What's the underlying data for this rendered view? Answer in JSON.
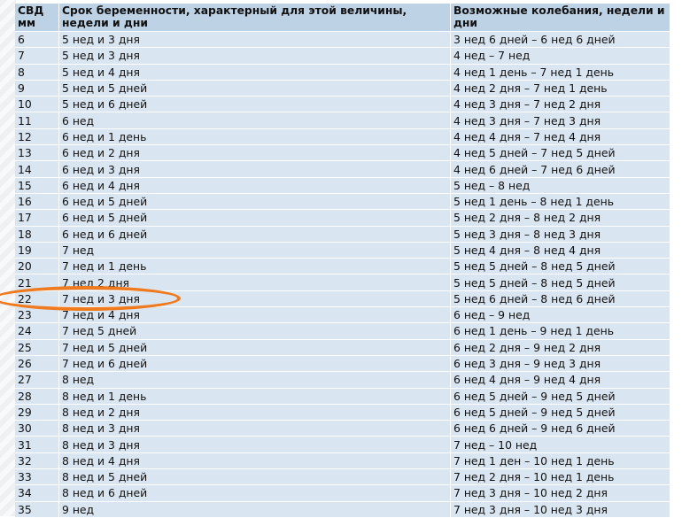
{
  "headers": {
    "col1": "СВД мм",
    "col2": "Срок беременности, характерный для этой величины, недели и дни",
    "col3": "Возможные колебания, недели и дни"
  },
  "rows": [
    [
      "6",
      "5 нед и 3 дня",
      "3 нед 6 дней – 6 нед 6 дней"
    ],
    [
      "7",
      "5 нед и 3 дня",
      "4 нед – 7 нед"
    ],
    [
      "8",
      "5 нед и 4 дня",
      "4 нед 1 день – 7 нед 1 день"
    ],
    [
      "9",
      "5 нед и 5 дней",
      "4 нед 2 дня – 7 нед 1 день"
    ],
    [
      "10",
      "5 нед и 6 дней",
      "4 нед 3 дня – 7 нед 2 дня"
    ],
    [
      "11",
      "6 нед",
      "4 нед 3 дня – 7 нед 3 дня"
    ],
    [
      "12",
      "6 нед и 1 день",
      "4 нед 4 дня – 7 нед 4 дня"
    ],
    [
      "13",
      "6 нед и 2 дня",
      "4 нед 5 дней – 7 нед 5 дней"
    ],
    [
      "14",
      "6 нед и 3 дня",
      "4 нед 6 дней – 7 нед 6 дней"
    ],
    [
      "15",
      "6 нед и 4 дня",
      "5 нед – 8 нед"
    ],
    [
      "16",
      "6 нед и 5 дней",
      "5 нед 1 день – 8 нед 1 день"
    ],
    [
      "17",
      "6 нед и 5 дней",
      "5 нед 2 дня – 8 нед 2 дня"
    ],
    [
      "18",
      "6 нед и 6 дней",
      "5 нед 3 дня – 8 нед 3 дня"
    ],
    [
      "19",
      "7 нед",
      "5 нед 4 дня – 8 нед 4 дня"
    ],
    [
      "20",
      "7 нед и 1 день",
      "5 нед 5 дней – 8 нед 5 дней"
    ],
    [
      "21",
      "7 нед 2 дня",
      "5 нед 5 дней – 8 нед 5 дней"
    ],
    [
      "22",
      "7 нед и 3 дня",
      "5 нед 6 дней – 8 нед 6 дней"
    ],
    [
      "23",
      "7 нед и 4 дня",
      "6 нед – 9 нед"
    ],
    [
      "24",
      "7 нед 5 дней",
      "6 нед 1 день – 9 нед 1 день"
    ],
    [
      "25",
      "7 нед и 5 дней",
      "6 нед 2 дня – 9 нед 2 дня"
    ],
    [
      "26",
      "7 нед и 6 дней",
      "6 нед 3 дня – 9 нед 3 дня"
    ],
    [
      "27",
      "8 нед",
      "6 нед 4 дня – 9 нед 4 дня"
    ],
    [
      "28",
      "8 нед и 1 день",
      "6 нед 5 дней – 9 нед 5 дней"
    ],
    [
      "29",
      "8 нед и 2 дня",
      "6 нед 5 дней – 9 нед 5 дней"
    ],
    [
      "30",
      "8 нед и 3 дня",
      "6 нед 6 дней – 9 нед 6 дней"
    ],
    [
      "31",
      "8 нед и 3 дня",
      "7 нед – 10 нед"
    ],
    [
      "32",
      "8 нед и 4 дня",
      "7 нед 1 ден – 10 нед 1 день"
    ],
    [
      "33",
      "8 нед и 5 дней",
      "7 нед 2 дня – 10 нед 1 день"
    ],
    [
      "34",
      "8 нед и 6 дней",
      "7 нед 3 дня – 10 нед 2 дня"
    ],
    [
      "35",
      "9 нед",
      "7 нед 3 дня – 10 нед 3 дня"
    ]
  ],
  "highlight": {
    "row_label": "22",
    "color": "#f07a1e"
  },
  "colors": {
    "header_bg": "#bed2e6",
    "cell_bg": "#d9e5f1"
  }
}
